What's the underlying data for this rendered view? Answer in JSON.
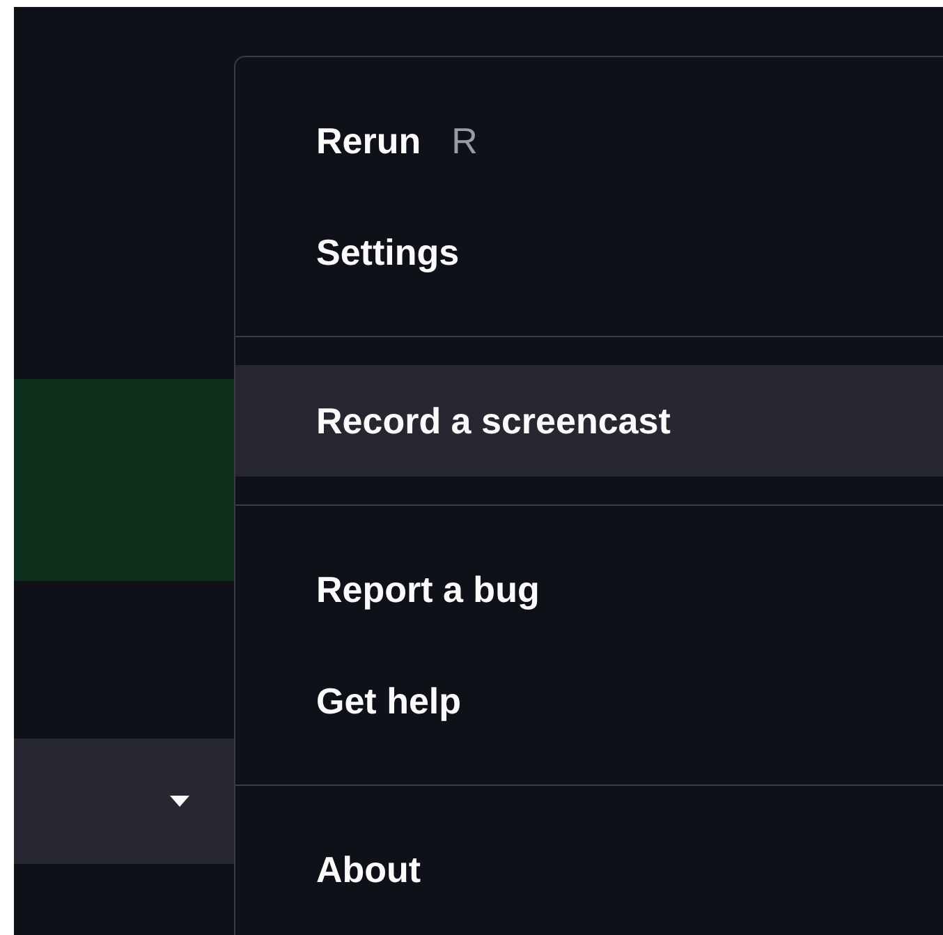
{
  "background": {
    "alert": {
      "kind": "success"
    },
    "select": {
      "expanded": false
    }
  },
  "menu": {
    "groups": [
      {
        "items": [
          {
            "label": "Rerun",
            "shortcut": "R",
            "selected": false
          },
          {
            "label": "Settings",
            "selected": false
          }
        ]
      },
      {
        "items": [
          {
            "label": "Record a screencast",
            "selected": true
          }
        ]
      },
      {
        "items": [
          {
            "label": "Report a bug",
            "selected": false
          },
          {
            "label": "Get help",
            "selected": false
          }
        ]
      },
      {
        "items": [
          {
            "label": "About",
            "selected": false
          }
        ]
      }
    ]
  }
}
